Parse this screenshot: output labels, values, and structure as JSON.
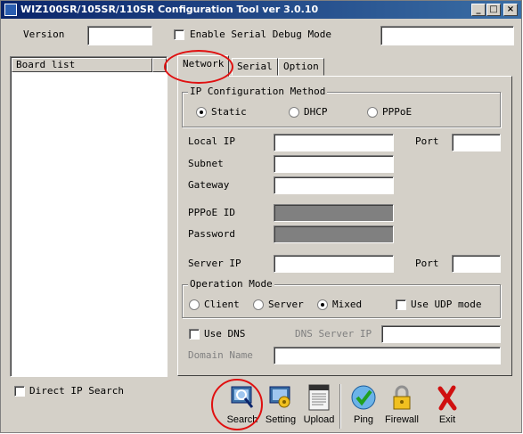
{
  "window": {
    "title": "WIZ100SR/105SR/110SR Configuration Tool ver 3.0.10",
    "minimize": "_",
    "maximize": "□",
    "close": "×"
  },
  "top": {
    "version_label": "Version",
    "version_value": "",
    "debug_label": "Enable Serial Debug Mode",
    "debug_checked": false
  },
  "board_list": {
    "header": "Board list",
    "items": []
  },
  "tabs": [
    {
      "label": "Network",
      "active": true
    },
    {
      "label": "Serial",
      "active": false
    },
    {
      "label": "Option",
      "active": false
    }
  ],
  "ip_config": {
    "title": "IP Configuration Method",
    "options": [
      "Static",
      "DHCP",
      "PPPoE"
    ],
    "selected": "Static"
  },
  "network": {
    "local_ip_label": "Local IP",
    "local_ip": "",
    "port_label": "Port",
    "port": "",
    "subnet_label": "Subnet",
    "subnet": "",
    "gateway_label": "Gateway",
    "gateway": "",
    "pppoe_id_label": "PPPoE ID",
    "pppoe_id": "",
    "password_label": "Password",
    "password": "",
    "server_ip_label": "Server IP",
    "server_ip": "",
    "server_port_label": "Port",
    "server_port": ""
  },
  "operation_mode": {
    "title": "Operation Mode",
    "options": [
      "Client",
      "Server",
      "Mixed"
    ],
    "selected": "Mixed",
    "udp_label": "Use UDP mode",
    "udp_checked": false
  },
  "dns": {
    "use_dns_label": "Use DNS",
    "use_dns_checked": false,
    "server_label": "DNS Server IP",
    "server_value": "",
    "domain_label": "Domain Name",
    "domain_value": ""
  },
  "direct_ip": {
    "label": "Direct IP Search",
    "checked": false
  },
  "toolbar": {
    "search": "Search",
    "setting": "Setting",
    "upload": "Upload",
    "ping": "Ping",
    "firewall": "Firewall",
    "exit": "Exit"
  },
  "colors": {
    "face": "#d4d0c8",
    "title_start": "#0a246a",
    "title_end": "#3a6ea5",
    "annotation": "#e01010"
  }
}
